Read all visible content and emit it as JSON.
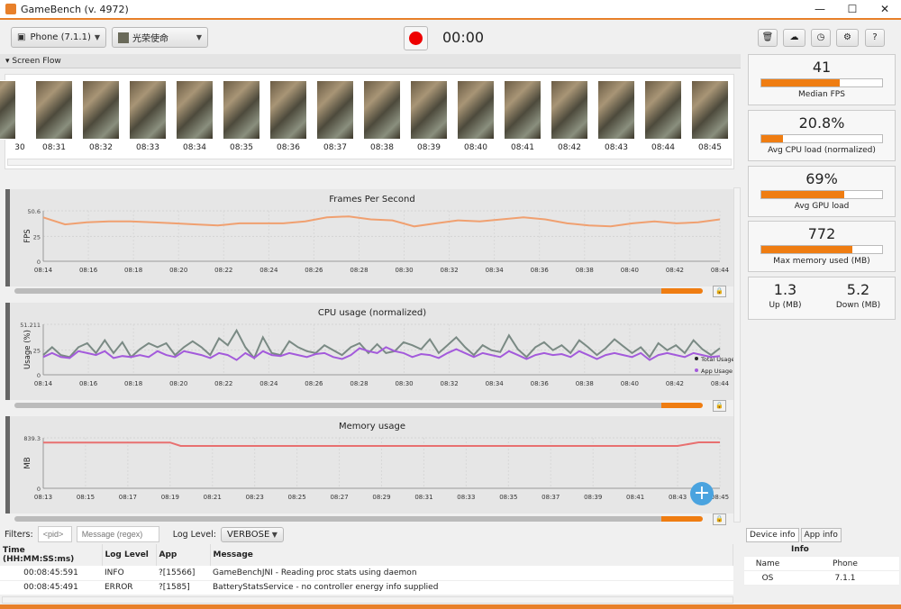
{
  "window": {
    "title": "GameBench (v. 4972)",
    "min": "—",
    "max": "☐",
    "close": "✕"
  },
  "toolbar": {
    "device": "Phone (7.1.1)",
    "app": "光荣使命",
    "timer": "00:00",
    "buttons": [
      "trash-icon",
      "cloud-upload-icon",
      "clock-icon",
      "settings-icon",
      "help-icon"
    ],
    "button_glyphs": [
      "🗑",
      "☁",
      "◷",
      "⚙",
      "?"
    ]
  },
  "screen_flow": {
    "title": "Screen Flow",
    "times": [
      "30",
      "08:31",
      "08:32",
      "08:33",
      "08:34",
      "08:35",
      "08:36",
      "08:37",
      "08:38",
      "08:39",
      "08:40",
      "08:41",
      "08:42",
      "08:43",
      "08:44",
      "08:45"
    ]
  },
  "stats": {
    "fps": {
      "value": "41",
      "label": "Median FPS",
      "fill": 0.65
    },
    "cpu": {
      "value": "20.8%",
      "label": "Avg CPU load (normalized)",
      "fill": 0.18
    },
    "gpu": {
      "value": "69%",
      "label": "Avg GPU load",
      "fill": 0.69
    },
    "mem": {
      "value": "772",
      "label": "Max memory used (MB)",
      "fill": 0.75
    },
    "net": {
      "up": "1.3",
      "up_label": "Up (MB)",
      "down": "5.2",
      "down_label": "Down (MB)"
    }
  },
  "chart_data": [
    {
      "type": "line",
      "title": "Frames Per Second",
      "ylabel": "FPS",
      "ylim": [
        0,
        50.6
      ],
      "yticks": [
        "0",
        "25",
        "50.6"
      ],
      "xticks": [
        "08:14",
        "08:16",
        "08:18",
        "08:20",
        "08:22",
        "08:24",
        "08:26",
        "08:28",
        "08:30",
        "08:32",
        "08:34",
        "08:36",
        "08:38",
        "08:40",
        "08:42",
        "08:44"
      ],
      "series": [
        {
          "color": "#f0a070",
          "values": [
            44,
            37,
            39,
            40,
            40,
            39,
            38,
            37,
            36,
            38,
            38,
            38,
            40,
            44,
            45,
            42,
            41,
            35,
            38,
            41,
            40,
            42,
            44,
            42,
            38,
            36,
            35,
            38,
            40,
            38,
            39,
            42
          ]
        }
      ]
    },
    {
      "type": "line",
      "title": "CPU usage (normalized)",
      "ylabel": "Usage (%)",
      "ylim": [
        0,
        51.211
      ],
      "yticks": [
        "0",
        "25",
        "51.211"
      ],
      "xticks": [
        "08:14",
        "08:16",
        "08:18",
        "08:20",
        "08:22",
        "08:24",
        "08:26",
        "08:28",
        "08:30",
        "08:32",
        "08:34",
        "08:36",
        "08:38",
        "08:40",
        "08:42",
        "08:44"
      ],
      "series": [
        {
          "name": "Total Usage",
          "color": "#7a8a84",
          "values": [
            20,
            28,
            20,
            18,
            28,
            32,
            22,
            35,
            22,
            33,
            18,
            26,
            32,
            28,
            32,
            20,
            28,
            34,
            28,
            20,
            37,
            30,
            45,
            28,
            17,
            38,
            22,
            20,
            34,
            28,
            24,
            22,
            30,
            25,
            20,
            28,
            32,
            22,
            31,
            22,
            24,
            33,
            30,
            26,
            36,
            22,
            30,
            38,
            28,
            20,
            30,
            25,
            23,
            40,
            26,
            18,
            28,
            33,
            25,
            30,
            22,
            35,
            28,
            20,
            27,
            36,
            29,
            22,
            28,
            18,
            32,
            25,
            30,
            22,
            35,
            26,
            20,
            27
          ]
        },
        {
          "name": "App Usage",
          "color": "#a35adb",
          "values": [
            18,
            22,
            18,
            17,
            24,
            22,
            20,
            24,
            17,
            19,
            18,
            20,
            18,
            24,
            20,
            18,
            24,
            22,
            20,
            17,
            22,
            20,
            15,
            22,
            17,
            24,
            20,
            19,
            22,
            20,
            18,
            21,
            22,
            18,
            16,
            20,
            27,
            24,
            22,
            28,
            24,
            22,
            18,
            21,
            20,
            17,
            22,
            26,
            22,
            18,
            22,
            20,
            18,
            24,
            20,
            16,
            20,
            22,
            20,
            21,
            18,
            24,
            20,
            16,
            20,
            22,
            20,
            18,
            22,
            15,
            20,
            22,
            20,
            18,
            22,
            20,
            18,
            19
          ]
        }
      ]
    },
    {
      "type": "line",
      "title": "Memory usage",
      "ylabel": "MB",
      "ylim": [
        0,
        839.3
      ],
      "yticks": [
        "0",
        "839.3"
      ],
      "xticks": [
        "08:13",
        "08:15",
        "08:17",
        "08:19",
        "08:21",
        "08:23",
        "08:25",
        "08:27",
        "08:29",
        "08:31",
        "08:33",
        "08:35",
        "08:37",
        "08:39",
        "08:41",
        "08:43",
        "08:45"
      ],
      "series": [
        {
          "color": "#e87070",
          "x": [
            0,
            3,
            6,
            6.5,
            10,
            16,
            22,
            28,
            28.5,
            30,
            31,
            32
          ],
          "values": [
            762,
            762,
            762,
            705,
            705,
            705,
            704,
            704,
            704,
            704,
            765,
            765
          ]
        }
      ]
    }
  ],
  "log": {
    "filters_label": "Filters:",
    "pid_placeholder": "<pid>",
    "msg_placeholder": "Message (regex)",
    "level_label": "Log Level:",
    "level": "VERBOSE",
    "headers": [
      "Time (HH:MM:SS:ms)",
      "Log Level",
      "App",
      "Message"
    ],
    "rows": [
      [
        "00:08:45:591",
        "INFO",
        "?[15566]",
        "GameBenchJNI - Reading proc stats using daemon"
      ],
      [
        "00:08:45:491",
        "ERROR",
        "?[1585]",
        "BatteryStatsService - no controller energy info supplied"
      ]
    ]
  },
  "info": {
    "tabs": [
      "Device info",
      "App info"
    ],
    "header": "Info",
    "rows": [
      [
        "Name",
        "Phone"
      ],
      [
        "OS",
        "7.1.1"
      ]
    ]
  }
}
